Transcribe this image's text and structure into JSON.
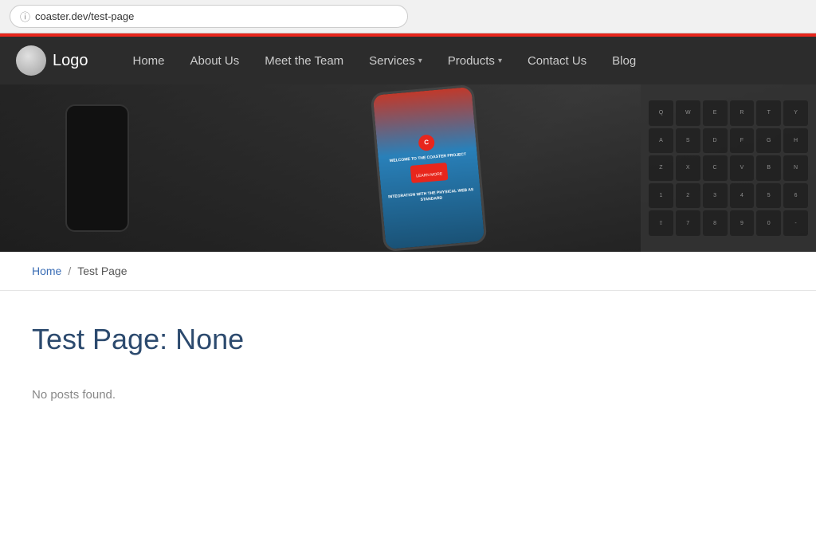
{
  "browser": {
    "url": "coaster.dev/test-page"
  },
  "nav": {
    "logo_text": "Logo",
    "links": [
      {
        "label": "Home",
        "has_dropdown": false
      },
      {
        "label": "About Us",
        "has_dropdown": false
      },
      {
        "label": "Meet the Team",
        "has_dropdown": false
      },
      {
        "label": "Services",
        "has_dropdown": true
      },
      {
        "label": "Products",
        "has_dropdown": true
      },
      {
        "label": "Contact Us",
        "has_dropdown": false
      },
      {
        "label": "Blog",
        "has_dropdown": false
      }
    ]
  },
  "hero": {
    "phone_lines": [
      "WELCOME TO THE COASTER PROJECT",
      "INTEGRATION WITH THE PHYSICAL WEB AS STANDARD"
    ]
  },
  "breadcrumb": {
    "home_label": "Home",
    "separator": "/",
    "current": "Test Page"
  },
  "main": {
    "title": "Test Page: None",
    "no_posts_message": "No posts found."
  },
  "keyboard_keys": [
    "Q",
    "W",
    "E",
    "R",
    "T",
    "Y",
    "A",
    "S",
    "D",
    "F",
    "G",
    "H",
    "Z",
    "X",
    "C",
    "V",
    "B",
    "N",
    "1",
    "2",
    "3",
    "4",
    "5",
    "6",
    "7",
    "8",
    "9",
    "0",
    "-",
    "="
  ]
}
